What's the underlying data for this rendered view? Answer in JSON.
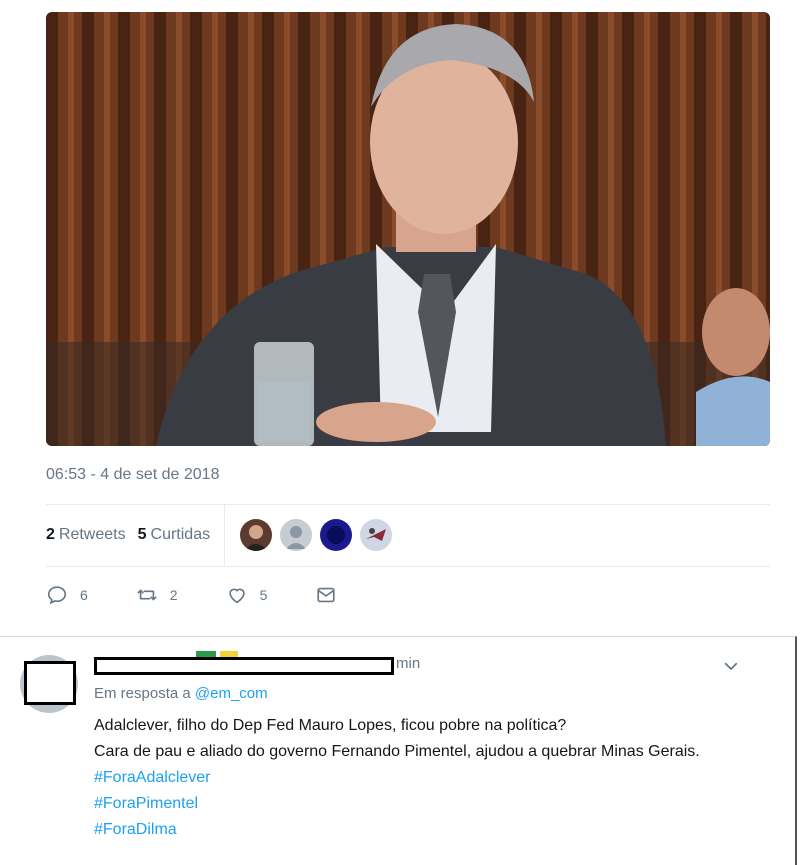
{
  "tweet": {
    "timestamp": "06:53 - 4 de set de 2018",
    "retweets_count": "2",
    "retweets_label": "Retweets",
    "likes_count": "5",
    "likes_label": "Curtidas",
    "actions": {
      "replies": "6",
      "retweets": "2",
      "likes": "5"
    }
  },
  "reply": {
    "time_suffix": "min",
    "in_reply_prefix": "Em resposta a",
    "mention": "@em_com",
    "lines": [
      "Adalclever, filho do Dep Fed Mauro Lopes, ficou pobre na política?",
      "Cara de pau e aliado do governo Fernando Pimentel, ajudou a quebrar Minas Gerais."
    ],
    "hashtags": [
      "#ForaAdalclever",
      "#ForaPimentel",
      "#ForaDilma"
    ]
  },
  "colors": {
    "accent": "#1da1f2",
    "muted": "#657786"
  },
  "icons": [
    "reply-icon",
    "retweet-icon",
    "like-icon",
    "dm-icon",
    "chevron-down-icon"
  ]
}
